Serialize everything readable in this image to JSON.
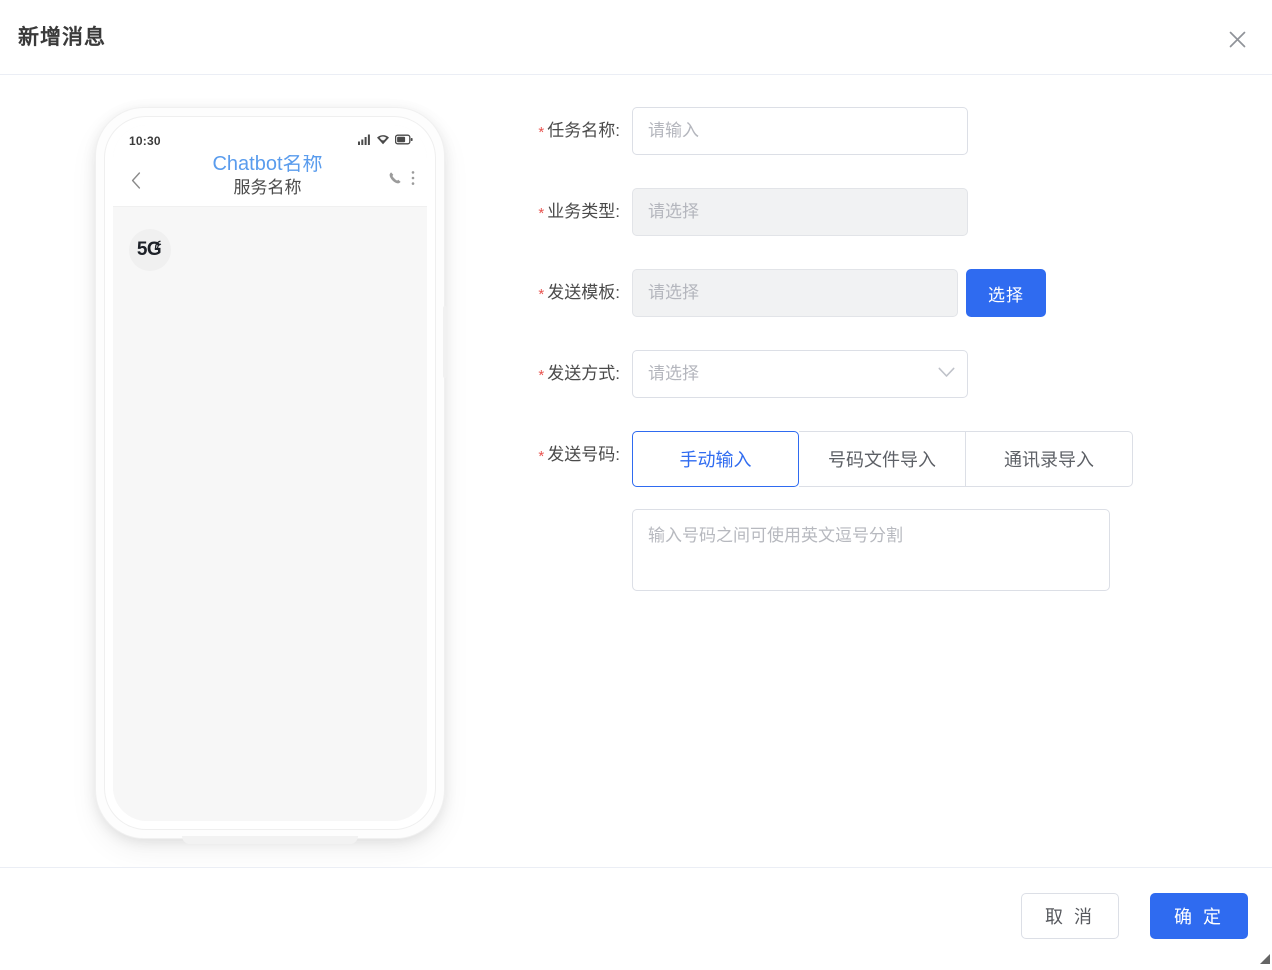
{
  "dialog": {
    "title": "新增消息",
    "close_icon": "close-icon"
  },
  "preview": {
    "status_bar": {
      "time": "10:30",
      "icons": [
        "signal-icon",
        "wifi-icon",
        "battery-icon"
      ]
    },
    "chat_header": {
      "back_icon": "chevron-left-icon",
      "bot_name": "Chatbot名称",
      "service_name": "服务名称",
      "call_icon": "phone-icon",
      "more_icon": "more-vertical-icon"
    },
    "avatar_label": "5G"
  },
  "form": {
    "rows": [
      {
        "label": "任务名称:",
        "required": "*",
        "placeholder": "请输入",
        "value": ""
      },
      {
        "label": "业务类型:",
        "required": "*",
        "placeholder": "请选择",
        "value": ""
      },
      {
        "label": "发送模板:",
        "required": "*",
        "placeholder": "请选择",
        "value": "",
        "button_label": "选择"
      },
      {
        "label": "发送方式:",
        "required": "*",
        "placeholder": "请选择",
        "value": "",
        "caret_icon": "chevron-down-icon"
      },
      {
        "label": "发送号码:",
        "required": "*"
      }
    ],
    "number_tabs": [
      {
        "label": "手动输入",
        "active": true
      },
      {
        "label": "号码文件导入",
        "active": false
      },
      {
        "label": "通讯录导入",
        "active": false
      }
    ],
    "number_textarea": {
      "placeholder": "输入号码之间可使用英文逗号分割",
      "value": ""
    }
  },
  "footer": {
    "cancel_label": "取 消",
    "confirm_label": "确 定"
  },
  "colors": {
    "primary": "#2f6bf0",
    "required_star": "#e8534f",
    "bot_name": "#5a9ced",
    "border": "#dcdfe6",
    "placeholder": "#b4b6bd"
  }
}
